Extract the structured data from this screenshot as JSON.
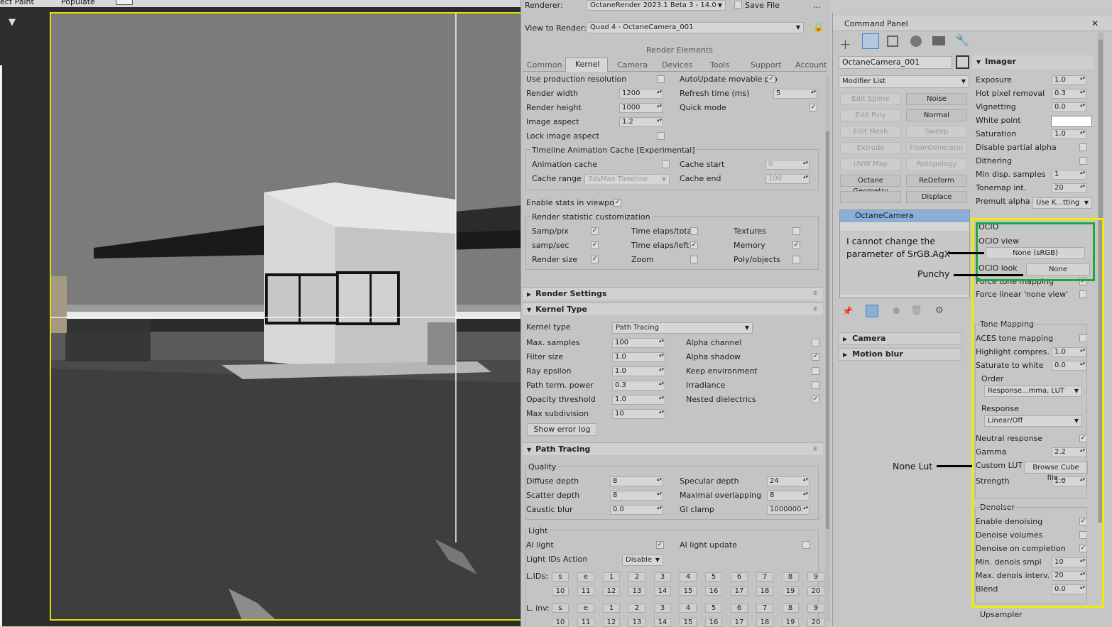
{
  "viewport": {
    "menu": [
      "ect Paint",
      "Populate"
    ]
  },
  "render_setup": {
    "renderer_label": "Renderer:",
    "renderer_value": "OctaneRender 2023.1 Beta 3 - 14.0",
    "save_file": "Save File",
    "more": "...",
    "view_label": "View to Render:",
    "view_value": "Quad 4 - OctaneCamera_001",
    "elements_header": "Render Elements",
    "tabs": [
      "Common",
      "Kernel",
      "Camera",
      "Devices",
      "Tools",
      "Support",
      "Account"
    ],
    "kernel": {
      "use_production": "Use production resolution",
      "autoupdate": "AutoUpdate movable pro",
      "render_width": "Render width",
      "render_width_val": "1200",
      "refresh_time": "Refresh time (ms)",
      "refresh_time_val": "5",
      "render_height": "Render height",
      "render_height_val": "1000",
      "quick_mode": "Quick mode",
      "image_aspect": "Image aspect",
      "image_aspect_val": "1.2",
      "lock_aspect": "Lock image aspect",
      "timeline_cache": "Timeline Animation Cache [Experimental]",
      "anim_cache": "Animation cache",
      "cache_start": "Cache start",
      "cache_start_val": "0",
      "cache_range": "Cache range",
      "cache_range_val": "3dsMax Timeline",
      "cache_end": "Cache end",
      "cache_end_val": "100",
      "enable_stats": "Enable stats in viewport",
      "stat_custom": "Render statistic customization",
      "samp_pix": "Samp/pix",
      "time_total": "Time elaps/total",
      "textures": "Textures",
      "samp_sec": "samp/sec",
      "time_left": "Time elaps/left",
      "memory": "Memory",
      "render_size": "Render size",
      "zoom": "Zoom",
      "poly_objects": "Poly/objects"
    },
    "sections": {
      "render_settings": "Render Settings",
      "kernel_type": "Kernel Type",
      "path_tracing": "Path Tracing"
    },
    "kt": {
      "kernel_type": "Kernel type",
      "kernel_type_val": "Path Tracing",
      "max_samples": "Max. samples",
      "max_samples_val": "100",
      "alpha_channel": "Alpha channel",
      "filter_size": "Filter size",
      "filter_size_val": "1.0",
      "alpha_shadow": "Alpha shadow",
      "ray_epsilon": "Ray epsilon",
      "ray_epsilon_val": "1.0",
      "keep_env": "Keep environment",
      "path_term": "Path term. power",
      "path_term_val": "0.3",
      "irradiance": "Irradiance",
      "opacity": "Opacity threshold",
      "opacity_val": "1.0",
      "nested": "Nested dielectrics",
      "max_subdiv": "Max subdivision",
      "max_subdiv_val": "10",
      "error_log": "Show error log"
    },
    "pt": {
      "quality": "Quality",
      "diffuse": "Diffuse depth",
      "diffuse_val": "8",
      "specular": "Specular depth",
      "specular_val": "24",
      "scatter": "Scatter depth",
      "scatter_val": "8",
      "overlap": "Maximal overlapping",
      "overlap_val": "8",
      "caustic": "Caustic blur",
      "caustic_val": "0.0",
      "gi_clamp": "GI clamp",
      "gi_clamp_val": "1000000.",
      "light": "Light",
      "ai_light": "AI light",
      "ai_update": "AI light update",
      "light_ids_action": "Light IDs Action",
      "light_ids_action_val": "Disable",
      "lids": "L.IDs:",
      "linv": "L. inv:",
      "id_row1": [
        "s",
        "e",
        "1",
        "2",
        "3",
        "4",
        "5",
        "6",
        "7",
        "8",
        "9"
      ],
      "id_row2": [
        "10",
        "11",
        "12",
        "13",
        "14",
        "15",
        "16",
        "17",
        "18",
        "19",
        "20"
      ]
    }
  },
  "command_panel": {
    "title": "Command Panel",
    "close": "✕",
    "object_name": "OctaneCamera_001",
    "modifier_list": "Modifier List",
    "modifiers": [
      [
        "Edit Spline",
        "Noise"
      ],
      [
        "Edit Poly",
        "Normal"
      ],
      [
        "Edit Mesh",
        "Sweep"
      ],
      [
        "Extrude",
        "FloorGenerator"
      ],
      [
        "UVW Map",
        "Retopology"
      ],
      [
        "Octane Geometry",
        "ReDeform"
      ],
      [
        "",
        "Displace"
      ]
    ],
    "stack_item": "OctaneCamera",
    "camera": "Camera",
    "motion_blur": "Motion blur",
    "imager": {
      "title": "Imager",
      "exposure": "Exposure",
      "exposure_val": "1.0",
      "hot_pixel": "Hot pixel removal",
      "hot_pixel_val": "0.3",
      "vignetting": "Vignetting",
      "vignetting_val": "0.0",
      "white_point": "White point",
      "saturation": "Saturation",
      "saturation_val": "1.0",
      "disable_partial": "Disable partial alpha",
      "dithering": "Dithering",
      "min_disp": "Min disp. samples",
      "min_disp_val": "1",
      "tonemap_int": "Tonemap int.",
      "tonemap_int_val": "20",
      "premult": "Premult alpha",
      "premult_val": "Use K...tting",
      "ocio": "OCIO",
      "ocio_view": "OCIO view",
      "ocio_view_val": "None (sRGB)",
      "ocio_look": "OCIO look",
      "ocio_look_val": "None",
      "force_tone": "Force tone mapping",
      "force_linear": "Force linear 'none view'",
      "tone_mapping": "Tone Mapping",
      "aces": "ACES tone mapping",
      "highlight": "Highlight compres.",
      "highlight_val": "1.0",
      "sat_white": "Saturate to white",
      "sat_white_val": "0.0",
      "order": "Order",
      "order_val": "Response...mma, LUT",
      "response": "Response",
      "response_val": "Linear/Off",
      "neutral": "Neutral response",
      "gamma": "Gamma",
      "gamma_val": "2.2",
      "custom_lut": "Custom LUT",
      "browse": "Browse Cube file...",
      "strength": "Strength",
      "strength_val": "1.0",
      "denoiser": "Denoiser",
      "enable_denoise": "Enable denoising",
      "denoise_vol": "Denoise volumes",
      "denoise_comp": "Denoise on completion",
      "min_denois": "Min. denois smpl",
      "min_denois_val": "10",
      "max_denois": "Max. denois interv.",
      "max_denois_val": "20",
      "blend": "Blend",
      "blend_val": "0.0",
      "upsampler": "Upsampler"
    }
  },
  "annotations": {
    "note1_line1": "I cannot change the",
    "note1_line2": "parameter of SrGB.AgX",
    "note2": "Punchy",
    "note3": "None Lut"
  },
  "colors": {
    "highlight_yellow": "#f0ec00",
    "highlight_green": "#1fa83a",
    "selection_blue": "#8aaed6"
  }
}
